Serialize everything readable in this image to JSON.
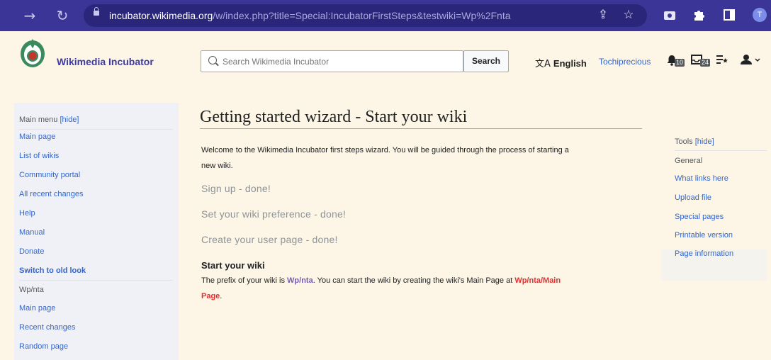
{
  "browser": {
    "url_host": "incubator.wikimedia.org",
    "url_rest": "/w/index.php?title=Special:IncubatorFirstSteps&testwiki=Wp%2Fnta",
    "profile_initial": "T"
  },
  "header": {
    "site_name": "Wikimedia Incubator",
    "search_placeholder": "Search Wikimedia Incubator",
    "search_button": "Search",
    "language": "English",
    "username": "Tochiprecious",
    "alerts_count": "10",
    "notices_count": "24"
  },
  "sidebar": {
    "main_menu_label": "Main menu",
    "hide_label": "[hide]",
    "items": [
      {
        "label": "Main page"
      },
      {
        "label": "List of wikis"
      },
      {
        "label": "Community portal"
      },
      {
        "label": "All recent changes"
      },
      {
        "label": "Help"
      },
      {
        "label": "Manual"
      },
      {
        "label": "Donate"
      },
      {
        "label": "Switch to old look"
      },
      {
        "label": "Wp/nta"
      },
      {
        "label": "Main page"
      },
      {
        "label": "Recent changes"
      },
      {
        "label": "Random page"
      }
    ]
  },
  "main": {
    "title": "Getting started wizard - Start your wiki",
    "intro_line1": "Welcome to the Wikimedia Incubator first steps wizard. You will be guided through the process of starting a",
    "intro_line2": "new wiki.",
    "steps": [
      {
        "label": "Sign up - done!"
      },
      {
        "label": "Set your wiki preference - done!"
      },
      {
        "label": "Create your user page - done!"
      }
    ],
    "start_heading": "Start your wiki",
    "prefix_text1": "The prefix of your wiki is ",
    "prefix_link": "Wp/nta",
    "prefix_text2": ". You can start the wiki by creating the wiki's Main Page at ",
    "main_page_link_part1": "Wp/nta/Main",
    "main_page_link_part2": "Page",
    "prefix_text3": "."
  },
  "tools": {
    "label": "Tools",
    "hide_label": "[hide]",
    "section": "General",
    "items": [
      {
        "label": "What links here"
      },
      {
        "label": "Upload file"
      },
      {
        "label": "Special pages"
      },
      {
        "label": "Printable version"
      },
      {
        "label": "Page information"
      }
    ]
  }
}
